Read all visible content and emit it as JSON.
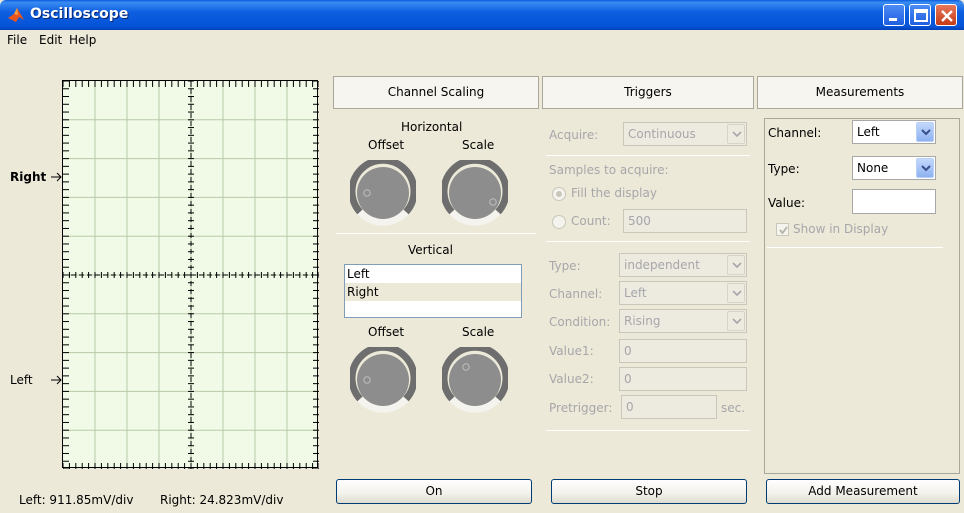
{
  "window": {
    "title": "Oscilloscope"
  },
  "menu": [
    "File",
    "Edit",
    "Help"
  ],
  "scope": {
    "channel_labels": [
      "Right",
      "Left"
    ],
    "readout_left": "Left: 911.85mV/div",
    "readout_right": "Right: 24.823mV/div"
  },
  "channel_scaling": {
    "header": "Channel Scaling",
    "horizontal_label": "Horizontal",
    "vertical_label": "Vertical",
    "offset_label": "Offset",
    "scale_label": "Scale",
    "channels": [
      "Left",
      "Right"
    ],
    "selected_channel": "Right",
    "on_button": "On"
  },
  "triggers": {
    "header": "Triggers",
    "acquire_label": "Acquire:",
    "acquire_value": "Continuous",
    "samples_label": "Samples to acquire:",
    "fill_label": "Fill the display",
    "count_label": "Count:",
    "count_value": "500",
    "type_label": "Type:",
    "type_value": "independent",
    "channel_label": "Channel:",
    "channel_value": "Left",
    "condition_label": "Condition:",
    "condition_value": "Rising",
    "value1_label": "Value1:",
    "value1_value": "0",
    "value2_label": "Value2:",
    "value2_value": "0",
    "pretrigger_label": "Pretrigger:",
    "pretrigger_value": "0",
    "pretrigger_unit": "sec.",
    "stop_button": "Stop"
  },
  "measurements": {
    "header": "Measurements",
    "channel_label": "Channel:",
    "channel_value": "Left",
    "type_label": "Type:",
    "type_value": "None",
    "value_label": "Value:",
    "value_value": "",
    "show_label": "Show in Display",
    "add_button": "Add Measurement"
  },
  "colors": {
    "titlebar": "#0553D8",
    "scope_bg": "#F0FAE6",
    "face": "#ECE9D8"
  }
}
